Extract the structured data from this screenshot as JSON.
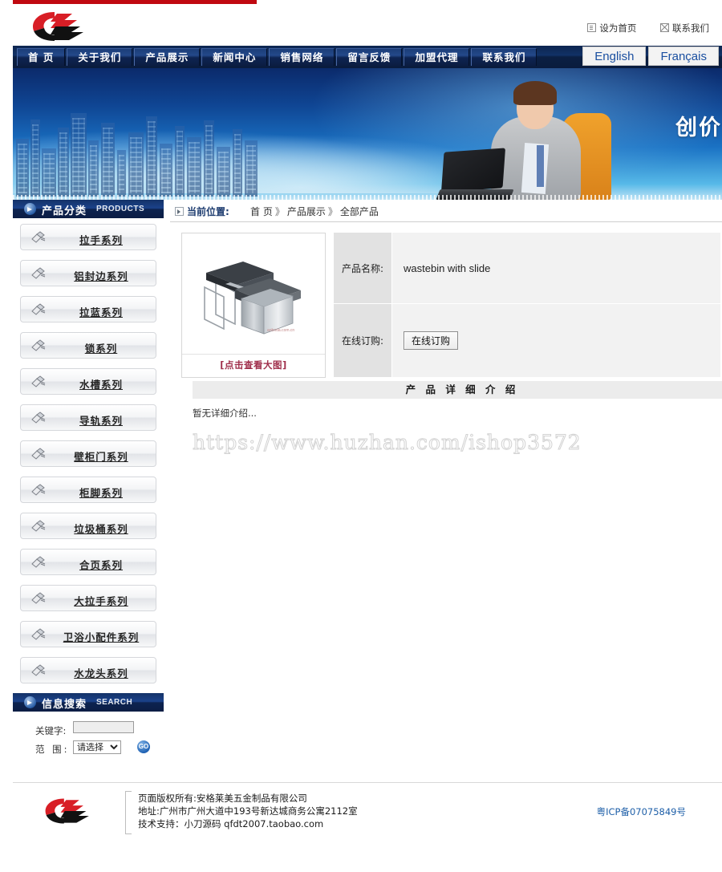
{
  "header": {
    "logo_alt": "company-logo",
    "links": [
      {
        "label": "设为首页",
        "icon": "page-icon"
      },
      {
        "label": "联系我们",
        "icon": "mail-icon"
      }
    ]
  },
  "nav": {
    "items": [
      {
        "label": "首 页"
      },
      {
        "label": "关于我们"
      },
      {
        "label": "产品展示"
      },
      {
        "label": "新闻中心"
      },
      {
        "label": "销售网络"
      },
      {
        "label": "留言反馈"
      },
      {
        "label": "加盟代理"
      },
      {
        "label": "联系我们"
      }
    ],
    "languages": [
      {
        "label": "English"
      },
      {
        "label": "Français"
      }
    ]
  },
  "banner": {
    "slogan": "创价"
  },
  "sidebar": {
    "products_panel": {
      "title_cn": "产品分类",
      "title_en": "PRODUCTS"
    },
    "categories": [
      {
        "label": "拉手系列"
      },
      {
        "label": "铝封边系列"
      },
      {
        "label": "拉蓝系列"
      },
      {
        "label": "锁系列"
      },
      {
        "label": "水槽系列"
      },
      {
        "label": "导轨系列"
      },
      {
        "label": "壁柜门系列"
      },
      {
        "label": "柜脚系列"
      },
      {
        "label": "垃圾桶系列"
      },
      {
        "label": "合页系列"
      },
      {
        "label": "大拉手系列"
      },
      {
        "label": "卫浴小配件系列"
      },
      {
        "label": "水龙头系列"
      }
    ],
    "search_panel": {
      "title_cn": "信息搜索",
      "title_en": "SEARCH",
      "keyword_label": "关键字:",
      "keyword_value": "",
      "keyword_placeholder": "",
      "scope_label": "范 围:",
      "scope_selected": "请选择",
      "scope_options": [
        "请选择"
      ],
      "go_label": "GO"
    }
  },
  "main": {
    "breadcrumb": {
      "label": "当前位置:",
      "items": [
        "首 页",
        "产品展示",
        "全部产品"
      ],
      "separator": "》"
    },
    "product": {
      "image_alt": "wastebin-product-photo",
      "zoom_link": "[点击查看大图]",
      "name_label": "产品名称:",
      "name_value": "wastebin with slide",
      "order_label": "在线订购:",
      "order_button": "在线订购"
    },
    "detail": {
      "title": "产 品 详 细 介 绍",
      "body": "暂无详细介绍..."
    },
    "watermark": "https://www.huzhan.com/ishop3572"
  },
  "footer": {
    "copyright": "页面版权所有:安格莱美五金制品有限公司",
    "address": "地址:广州市广州大道中193号新达城商务公寓2112室",
    "support": "技术支持：小刀源码 qfdt2007.taobao.com",
    "icp": "粤ICP备07075849号"
  },
  "colors": {
    "accent_red": "#c00810",
    "nav_blue": "#113166",
    "panel_blue": "#1b428a",
    "link_blue": "#1a4fa0",
    "zoom_link": "#a0304c"
  }
}
